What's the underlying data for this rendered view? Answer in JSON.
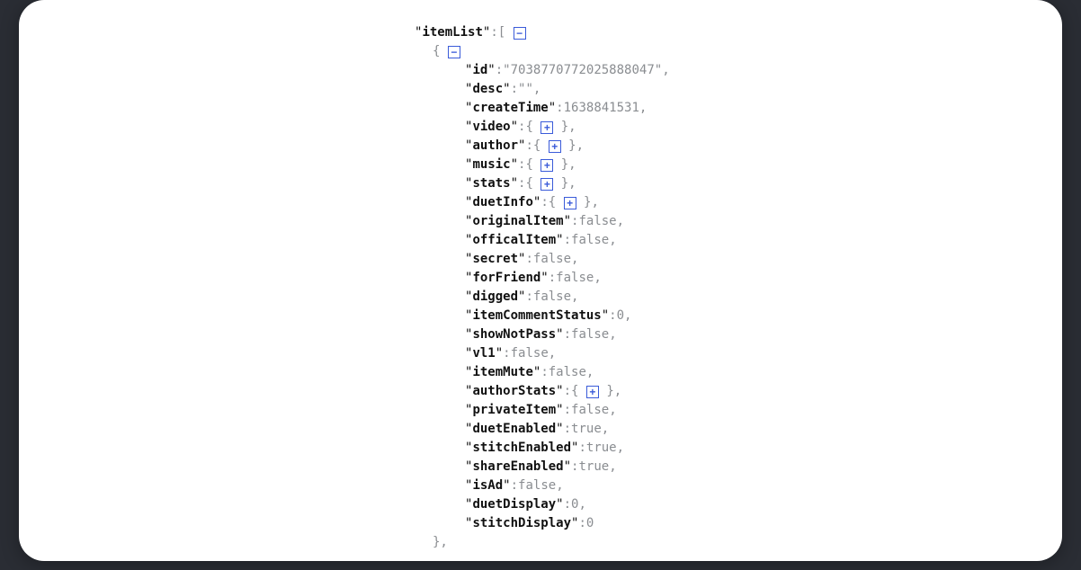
{
  "json": {
    "rootKey": "itemList",
    "item": {
      "id": "7038770772025888047",
      "desc": "",
      "createTime": 1638841531,
      "video_label": "video",
      "author_label": "author",
      "music_label": "music",
      "stats_label": "stats",
      "duetInfo_label": "duetInfo",
      "originalItem": "false",
      "officalItem": "false",
      "secret": "false",
      "forFriend": "false",
      "digged": "false",
      "itemCommentStatus": 0,
      "showNotPass": "false",
      "vl1": "false",
      "itemMute": "false",
      "authorStats_label": "authorStats",
      "privateItem": "false",
      "duetEnabled": "true",
      "stitchEnabled": "true",
      "shareEnabled": "true",
      "isAd": "false",
      "duetDisplay": 0,
      "stitchDisplay": 0
    },
    "toggle_collapse": "−",
    "toggle_expand": "+"
  }
}
